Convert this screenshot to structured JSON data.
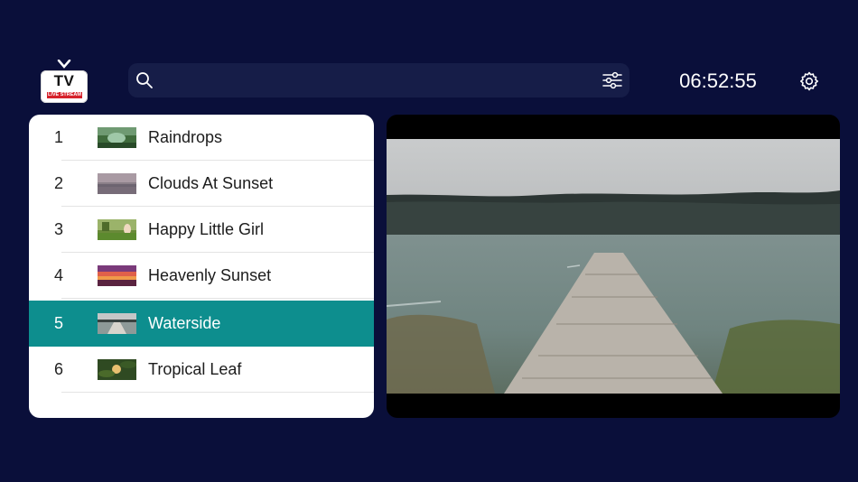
{
  "logo": {
    "title": "TV",
    "subtitle": "LIVE STREAM"
  },
  "search": {
    "value": "",
    "placeholder": ""
  },
  "clock": {
    "time": "06:52:55"
  },
  "channels": [
    {
      "number": "1",
      "title": "Raindrops"
    },
    {
      "number": "2",
      "title": "Clouds At Sunset"
    },
    {
      "number": "3",
      "title": "Happy Little Girl"
    },
    {
      "number": "4",
      "title": "Heavenly Sunset"
    },
    {
      "number": "5",
      "title": "Waterside",
      "selected": true
    },
    {
      "number": "6",
      "title": "Tropical Leaf"
    }
  ],
  "icons": {
    "search": "search-icon",
    "filter": "sliders-icon",
    "settings": "gear-icon"
  },
  "colors": {
    "background": "#0a0f3a",
    "search_bar": "#161d48",
    "selected_row": "#0d8e8e",
    "logo_badge": "#d6212a"
  }
}
